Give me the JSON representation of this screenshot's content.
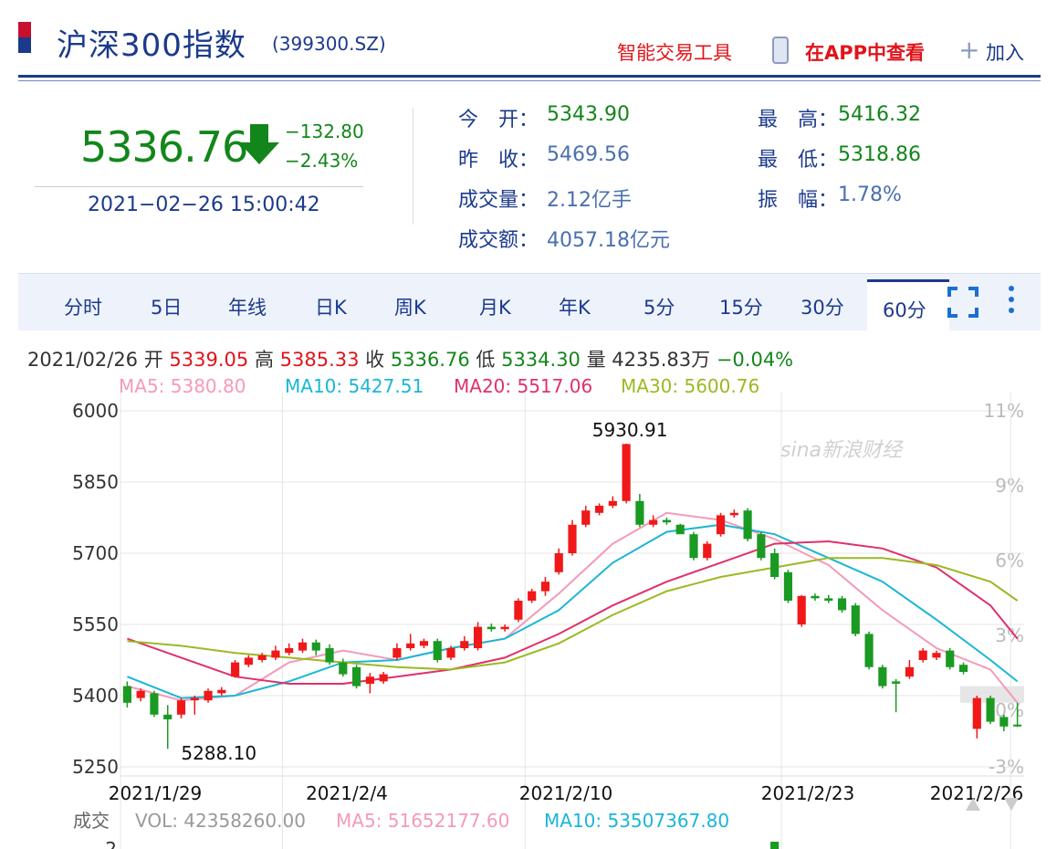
{
  "header": {
    "title": "沪深300指数",
    "code": "(399300.SZ)",
    "tool_link": "智能交易工具",
    "app_link": "在APP中查看",
    "add_label": "加入"
  },
  "quote": {
    "price": "5336.76",
    "change": "−132.80",
    "change_pct": "−2.43%",
    "datetime": "2021−02−26 15:00:42",
    "open_label": "今　开：",
    "open": "5343.90",
    "prev_label": "昨　收：",
    "prev": "5469.56",
    "vol_label": "成交量：",
    "vol": "2.12亿手",
    "amount_label": "成交额：",
    "amount": "4057.18亿元",
    "high_label": "最　高：",
    "high": "5416.32",
    "low_label": "最　低：",
    "low": "5318.86",
    "amp_label": "振　幅：",
    "amp": "1.78%"
  },
  "tabs": [
    "分时",
    "5日",
    "年线",
    "日K",
    "周K",
    "月K",
    "年K",
    "5分",
    "15分",
    "30分",
    "60分"
  ],
  "active_tab": "60分",
  "bar_info": {
    "date": "2021/02/26",
    "open_label": "开",
    "open": "5339.05",
    "high_label": "高",
    "high": "5385.33",
    "close_label": "收",
    "close": "5336.76",
    "low_label": "低",
    "low": "5334.30",
    "vol_label": "量",
    "vol": "4235.83万",
    "pct": "−0.04%"
  },
  "ma_legend": {
    "ma5": "MA5: 5380.80",
    "ma10": "MA10: 5427.51",
    "ma20": "MA20: 5517.06",
    "ma30": "MA30: 5600.76"
  },
  "volume_legend": {
    "label": "成交",
    "vol": "VOL: 42358260.00",
    "ma5": "MA5: 51652177.60",
    "ma10": "MA10: 53507367.80",
    "axis_tick": "2"
  },
  "watermark": "sina新浪财经",
  "colors": {
    "up": "#f01818",
    "down": "#1a9a22",
    "ma5": "#f59ab8",
    "ma10": "#1ab6d6",
    "ma20": "#e0306a",
    "ma30": "#9aba22",
    "brand_blue": "#1b3a8c"
  },
  "chart_data": {
    "type": "candlestick",
    "ylim": [
      5250,
      6000
    ],
    "y_ticks": [
      "6000",
      "5850",
      "5700",
      "5550",
      "5400",
      "5250"
    ],
    "pct_ticks": [
      "11%",
      "9%",
      "6%",
      "3%",
      "0%",
      "-3%"
    ],
    "x_labels": [
      "2021/1/29",
      "2021/2/4",
      "2021/2/10",
      "2021/2/23",
      "2021/2/26"
    ],
    "annotations": {
      "max": "5930.91",
      "min": "5288.10"
    },
    "candles": [
      {
        "o": 5420,
        "c": 5385,
        "h": 5430,
        "l": 5375
      },
      {
        "o": 5395,
        "c": 5410,
        "h": 5415,
        "l": 5388
      },
      {
        "o": 5405,
        "c": 5360,
        "h": 5410,
        "l": 5355
      },
      {
        "o": 5360,
        "c": 5350,
        "h": 5380,
        "l": 5288
      },
      {
        "o": 5360,
        "c": 5390,
        "h": 5395,
        "l": 5352
      },
      {
        "o": 5390,
        "c": 5395,
        "h": 5400,
        "l": 5360
      },
      {
        "o": 5390,
        "c": 5410,
        "h": 5415,
        "l": 5385
      },
      {
        "o": 5405,
        "c": 5412,
        "h": 5418,
        "l": 5400
      },
      {
        "o": 5440,
        "c": 5470,
        "h": 5475,
        "l": 5438
      },
      {
        "o": 5465,
        "c": 5480,
        "h": 5485,
        "l": 5460
      },
      {
        "o": 5475,
        "c": 5485,
        "h": 5490,
        "l": 5470
      },
      {
        "o": 5480,
        "c": 5495,
        "h": 5505,
        "l": 5475
      },
      {
        "o": 5490,
        "c": 5500,
        "h": 5510,
        "l": 5485
      },
      {
        "o": 5495,
        "c": 5512,
        "h": 5520,
        "l": 5490
      },
      {
        "o": 5512,
        "c": 5495,
        "h": 5518,
        "l": 5485
      },
      {
        "o": 5500,
        "c": 5470,
        "h": 5508,
        "l": 5465
      },
      {
        "o": 5470,
        "c": 5445,
        "h": 5478,
        "l": 5440
      },
      {
        "o": 5460,
        "c": 5420,
        "h": 5465,
        "l": 5415
      },
      {
        "o": 5425,
        "c": 5440,
        "h": 5448,
        "l": 5405
      },
      {
        "o": 5430,
        "c": 5445,
        "h": 5450,
        "l": 5425
      },
      {
        "o": 5480,
        "c": 5500,
        "h": 5510,
        "l": 5475
      },
      {
        "o": 5500,
        "c": 5510,
        "h": 5530,
        "l": 5495
      },
      {
        "o": 5505,
        "c": 5515,
        "h": 5520,
        "l": 5500
      },
      {
        "o": 5515,
        "c": 5475,
        "h": 5520,
        "l": 5470
      },
      {
        "o": 5480,
        "c": 5500,
        "h": 5505,
        "l": 5475
      },
      {
        "o": 5500,
        "c": 5515,
        "h": 5525,
        "l": 5495
      },
      {
        "o": 5500,
        "c": 5545,
        "h": 5555,
        "l": 5495
      },
      {
        "o": 5545,
        "c": 5540,
        "h": 5552,
        "l": 5535
      },
      {
        "o": 5540,
        "c": 5545,
        "h": 5550,
        "l": 5535
      },
      {
        "o": 5560,
        "c": 5600,
        "h": 5605,
        "l": 5555
      },
      {
        "o": 5600,
        "c": 5620,
        "h": 5625,
        "l": 5595
      },
      {
        "o": 5620,
        "c": 5640,
        "h": 5650,
        "l": 5610
      },
      {
        "o": 5660,
        "c": 5700,
        "h": 5710,
        "l": 5655
      },
      {
        "o": 5700,
        "c": 5760,
        "h": 5770,
        "l": 5695
      },
      {
        "o": 5760,
        "c": 5790,
        "h": 5800,
        "l": 5755
      },
      {
        "o": 5785,
        "c": 5800,
        "h": 5805,
        "l": 5780
      },
      {
        "o": 5800,
        "c": 5810,
        "h": 5820,
        "l": 5795
      },
      {
        "o": 5810,
        "c": 5930,
        "h": 5931,
        "l": 5805
      },
      {
        "o": 5810,
        "c": 5760,
        "h": 5825,
        "l": 5755
      },
      {
        "o": 5760,
        "c": 5770,
        "h": 5780,
        "l": 5755
      },
      {
        "o": 5770,
        "c": 5765,
        "h": 5775,
        "l": 5760
      },
      {
        "o": 5760,
        "c": 5740,
        "h": 5762,
        "l": 5745
      },
      {
        "o": 5740,
        "c": 5690,
        "h": 5745,
        "l": 5685
      },
      {
        "o": 5690,
        "c": 5720,
        "h": 5725,
        "l": 5685
      },
      {
        "o": 5740,
        "c": 5780,
        "h": 5785,
        "l": 5735
      },
      {
        "o": 5780,
        "c": 5785,
        "h": 5792,
        "l": 5775
      },
      {
        "o": 5790,
        "c": 5730,
        "h": 5795,
        "l": 5725
      },
      {
        "o": 5740,
        "c": 5690,
        "h": 5745,
        "l": 5685
      },
      {
        "o": 5700,
        "c": 5650,
        "h": 5710,
        "l": 5645
      },
      {
        "o": 5660,
        "c": 5600,
        "h": 5665,
        "l": 5595
      },
      {
        "o": 5550,
        "c": 5610,
        "h": 5612,
        "l": 5545
      },
      {
        "o": 5610,
        "c": 5605,
        "h": 5615,
        "l": 5600
      },
      {
        "o": 5605,
        "c": 5600,
        "h": 5612,
        "l": 5595
      },
      {
        "o": 5605,
        "c": 5580,
        "h": 5610,
        "l": 5575
      },
      {
        "o": 5590,
        "c": 5530,
        "h": 5595,
        "l": 5525
      },
      {
        "o": 5530,
        "c": 5460,
        "h": 5535,
        "l": 5455
      },
      {
        "o": 5460,
        "c": 5420,
        "h": 5465,
        "l": 5415
      },
      {
        "o": 5430,
        "c": 5425,
        "h": 5435,
        "l": 5365
      },
      {
        "o": 5440,
        "c": 5460,
        "h": 5475,
        "l": 5435
      },
      {
        "o": 5475,
        "c": 5495,
        "h": 5500,
        "l": 5470
      },
      {
        "o": 5480,
        "c": 5490,
        "h": 5495,
        "l": 5475
      },
      {
        "o": 5495,
        "c": 5460,
        "h": 5500,
        "l": 5455
      },
      {
        "o": 5465,
        "c": 5450,
        "h": 5470,
        "l": 5445
      },
      {
        "o": 5330,
        "c": 5395,
        "h": 5400,
        "l": 5310
      },
      {
        "o": 5395,
        "c": 5345,
        "h": 5400,
        "l": 5340
      },
      {
        "o": 5355,
        "c": 5335,
        "h": 5360,
        "l": 5325
      },
      {
        "o": 5339,
        "c": 5337,
        "h": 5385,
        "l": 5334
      }
    ],
    "ma_series": [
      {
        "name": "MA5",
        "values": [
          [
            0,
            5420
          ],
          [
            4,
            5390
          ],
          [
            8,
            5400
          ],
          [
            12,
            5470
          ],
          [
            16,
            5495
          ],
          [
            20,
            5475
          ],
          [
            24,
            5500
          ],
          [
            28,
            5520
          ],
          [
            32,
            5615
          ],
          [
            36,
            5720
          ],
          [
            40,
            5785
          ],
          [
            44,
            5770
          ],
          [
            48,
            5730
          ],
          [
            52,
            5675
          ],
          [
            56,
            5580
          ],
          [
            60,
            5500
          ],
          [
            64,
            5455
          ],
          [
            66,
            5385
          ]
        ]
      },
      {
        "name": "MA10",
        "values": [
          [
            0,
            5440
          ],
          [
            4,
            5395
          ],
          [
            8,
            5400
          ],
          [
            12,
            5430
          ],
          [
            16,
            5470
          ],
          [
            20,
            5475
          ],
          [
            24,
            5500
          ],
          [
            28,
            5520
          ],
          [
            32,
            5580
          ],
          [
            36,
            5680
          ],
          [
            40,
            5745
          ],
          [
            44,
            5760
          ],
          [
            48,
            5740
          ],
          [
            52,
            5690
          ],
          [
            56,
            5640
          ],
          [
            60,
            5560
          ],
          [
            64,
            5475
          ],
          [
            66,
            5430
          ]
        ]
      },
      {
        "name": "MA20",
        "values": [
          [
            0,
            5520
          ],
          [
            4,
            5480
          ],
          [
            8,
            5440
          ],
          [
            12,
            5425
          ],
          [
            16,
            5425
          ],
          [
            20,
            5440
          ],
          [
            24,
            5455
          ],
          [
            28,
            5480
          ],
          [
            32,
            5530
          ],
          [
            36,
            5590
          ],
          [
            40,
            5640
          ],
          [
            44,
            5680
          ],
          [
            48,
            5720
          ],
          [
            52,
            5725
          ],
          [
            56,
            5710
          ],
          [
            60,
            5670
          ],
          [
            64,
            5590
          ],
          [
            66,
            5520
          ]
        ]
      },
      {
        "name": "MA30",
        "values": [
          [
            0,
            5515
          ],
          [
            4,
            5505
          ],
          [
            8,
            5490
          ],
          [
            12,
            5480
          ],
          [
            16,
            5470
          ],
          [
            20,
            5460
          ],
          [
            24,
            5455
          ],
          [
            28,
            5470
          ],
          [
            32,
            5510
          ],
          [
            36,
            5570
          ],
          [
            40,
            5620
          ],
          [
            44,
            5650
          ],
          [
            48,
            5670
          ],
          [
            52,
            5690
          ],
          [
            56,
            5690
          ],
          [
            60,
            5675
          ],
          [
            64,
            5640
          ],
          [
            66,
            5600
          ]
        ]
      }
    ],
    "volume_bars": [
      {
        "i": 48,
        "dir": "down"
      }
    ]
  }
}
